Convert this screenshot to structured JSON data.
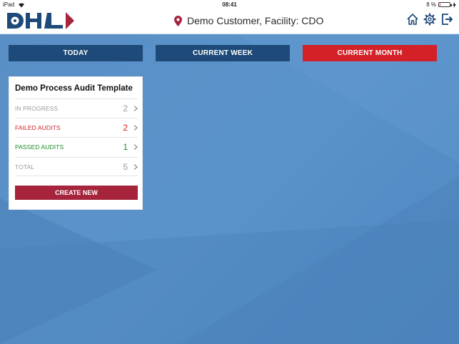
{
  "statusbar": {
    "device": "iPad",
    "time": "08:41",
    "battery": "8 %",
    "battery_level": 0.08
  },
  "header": {
    "location": "Demo Customer, Facility: CDO"
  },
  "tabs": [
    {
      "label": "TODAY",
      "active": false
    },
    {
      "label": "CURRENT WEEK",
      "active": false
    },
    {
      "label": "CURRENT MONTH",
      "active": true
    }
  ],
  "card": {
    "title": "Demo Process Audit Template",
    "rows": [
      {
        "label": "IN PROGRESS",
        "value": "2"
      },
      {
        "label": "FAILED AUDITS",
        "value": "2"
      },
      {
        "label": "PASSED AUDITS",
        "value": "1"
      },
      {
        "label": "TOTAL",
        "value": "5"
      }
    ],
    "create_label": "CREATE NEW"
  },
  "colors": {
    "navy": "#1d4a78",
    "red": "#d42027",
    "maroon": "#a6243c",
    "green": "#1e8a2a",
    "background": "#5a8fc6"
  }
}
